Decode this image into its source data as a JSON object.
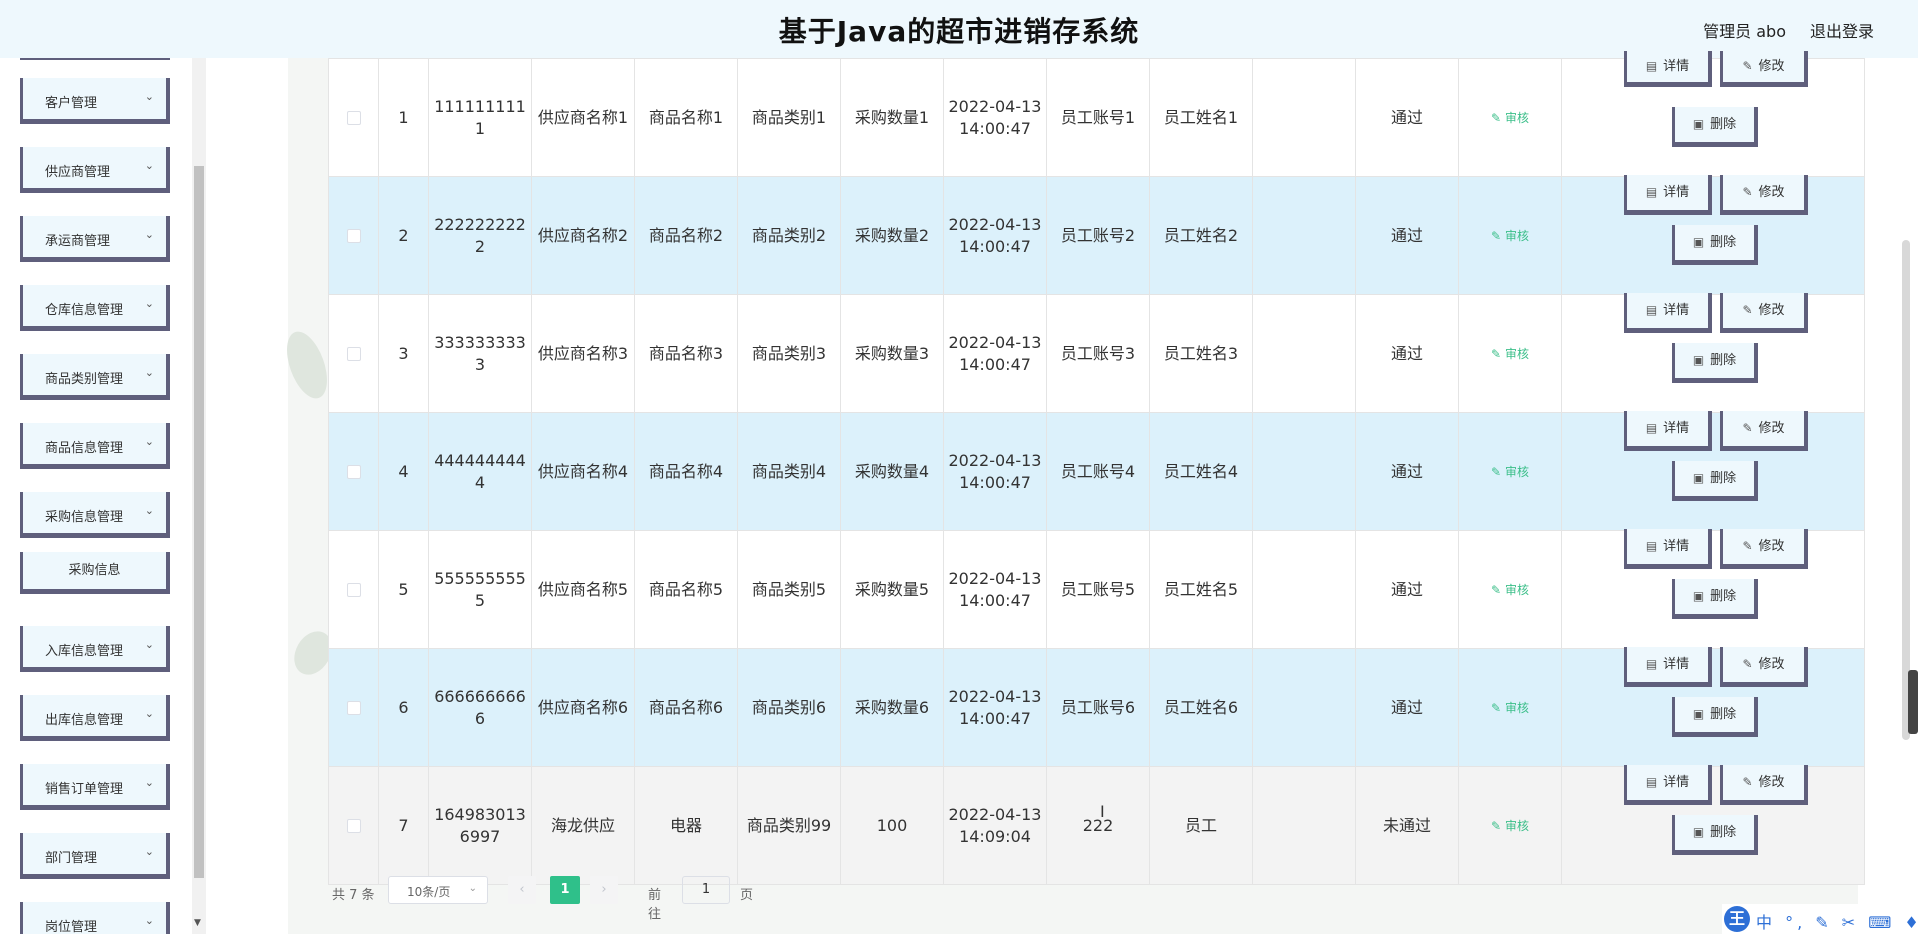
{
  "header": {
    "title": "基于Java的超市进销存系统",
    "user": "管理员 abo",
    "logout": "退出登录"
  },
  "sidebar": {
    "items": [
      {
        "label": "客户管理"
      },
      {
        "label": "供应商管理"
      },
      {
        "label": "承运商管理"
      },
      {
        "label": "仓库信息管理"
      },
      {
        "label": "商品类别管理"
      },
      {
        "label": "商品信息管理"
      },
      {
        "label": "采购信息管理"
      },
      {
        "label": "入库信息管理"
      },
      {
        "label": "出库信息管理"
      },
      {
        "label": "销售订单管理"
      },
      {
        "label": "部门管理"
      },
      {
        "label": "岗位管理"
      }
    ],
    "sub_item": "采购信息"
  },
  "table": {
    "rows": [
      {
        "index": "1",
        "no": "1111111111",
        "supplier": "供应商名称1",
        "product": "商品名称1",
        "category": "商品类别1",
        "qty": "采购数量1",
        "time": "2022-04-13 14:00:47",
        "account": "员工账号1",
        "name": "员工姓名1",
        "remark": "",
        "status": "通过"
      },
      {
        "index": "2",
        "no": "2222222222",
        "supplier": "供应商名称2",
        "product": "商品名称2",
        "category": "商品类别2",
        "qty": "采购数量2",
        "time": "2022-04-13 14:00:47",
        "account": "员工账号2",
        "name": "员工姓名2",
        "remark": "",
        "status": "通过"
      },
      {
        "index": "3",
        "no": "3333333333",
        "supplier": "供应商名称3",
        "product": "商品名称3",
        "category": "商品类别3",
        "qty": "采购数量3",
        "time": "2022-04-13 14:00:47",
        "account": "员工账号3",
        "name": "员工姓名3",
        "remark": "",
        "status": "通过"
      },
      {
        "index": "4",
        "no": "4444444444",
        "supplier": "供应商名称4",
        "product": "商品名称4",
        "category": "商品类别4",
        "qty": "采购数量4",
        "time": "2022-04-13 14:00:47",
        "account": "员工账号4",
        "name": "员工姓名4",
        "remark": "",
        "status": "通过"
      },
      {
        "index": "5",
        "no": "5555555555",
        "supplier": "供应商名称5",
        "product": "商品名称5",
        "category": "商品类别5",
        "qty": "采购数量5",
        "time": "2022-04-13 14:00:47",
        "account": "员工账号5",
        "name": "员工姓名5",
        "remark": "",
        "status": "通过"
      },
      {
        "index": "6",
        "no": "6666666666",
        "supplier": "供应商名称6",
        "product": "商品名称6",
        "category": "商品类别6",
        "qty": "采购数量6",
        "time": "2022-04-13 14:00:47",
        "account": "员工账号6",
        "name": "员工姓名6",
        "remark": "",
        "status": "通过"
      },
      {
        "index": "7",
        "no": "1649830136997",
        "supplier": "海龙供应",
        "product": "电器",
        "category": "商品类别99",
        "qty": "100",
        "time": "2022-04-13 14:09:04",
        "account": "222",
        "name": "员工",
        "remark": "",
        "status": "未通过"
      }
    ],
    "audit_label": "审核",
    "detail_label": "详情",
    "edit_label": "修改",
    "delete_label": "删除"
  },
  "pagination": {
    "total": "共 7 条",
    "page_size": "10条/页",
    "current_page": "1",
    "goto_label": "前往",
    "goto_value": "1",
    "page_unit": "页"
  },
  "ime": {
    "logo": "王",
    "tools": "中 °, ✎ ✂ ⌨ ♦ ⚙"
  }
}
